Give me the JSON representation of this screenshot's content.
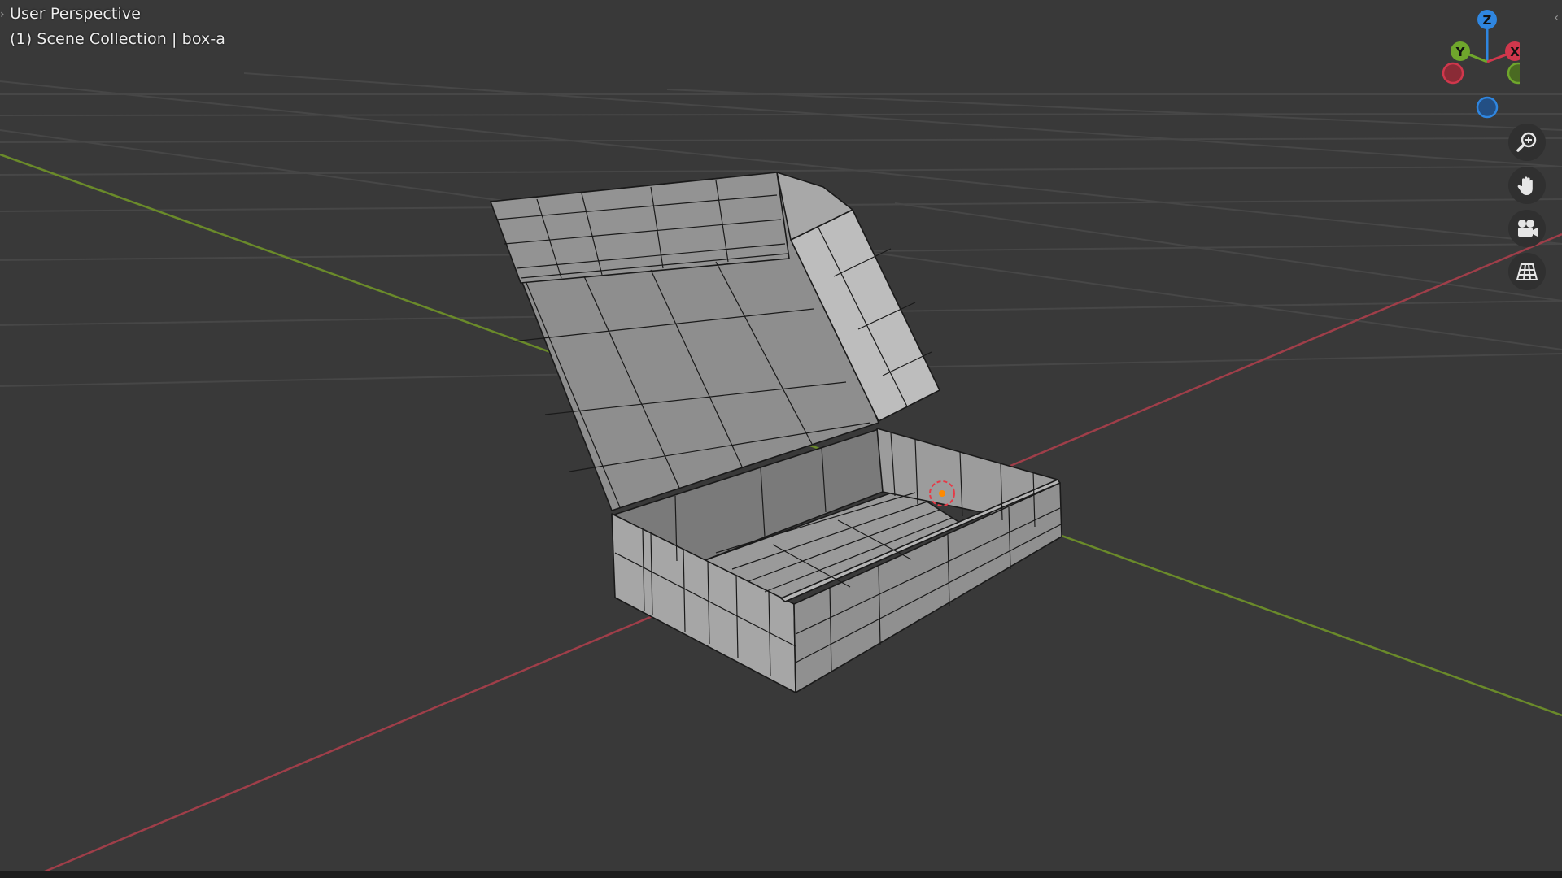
{
  "viewport": {
    "view_name": "User Perspective",
    "collection_text": "(1) Scene Collection | box-a",
    "background_color": "#393939",
    "grid_color": "#454545",
    "x_axis_color": "#a4444f",
    "y_axis_color": "#6e8a2c"
  },
  "gizmo": {
    "z_label": "Z",
    "y_label": "Y",
    "x_label": "X",
    "z_color": "#2f86e0",
    "y_color": "#6fa62c",
    "x_color": "#d0374c"
  },
  "nav_buttons": [
    {
      "name": "zoom",
      "icon": "zoom-icon"
    },
    {
      "name": "pan",
      "icon": "hand-icon"
    },
    {
      "name": "camera",
      "icon": "camera-icon"
    },
    {
      "name": "ortho",
      "icon": "grid-icon"
    }
  ],
  "mesh": {
    "face_color": "#8f8f8f",
    "light_face_color": "#bcbcbc",
    "wire_color": "#1a1a1a",
    "origin_color": "#ff8a00"
  }
}
